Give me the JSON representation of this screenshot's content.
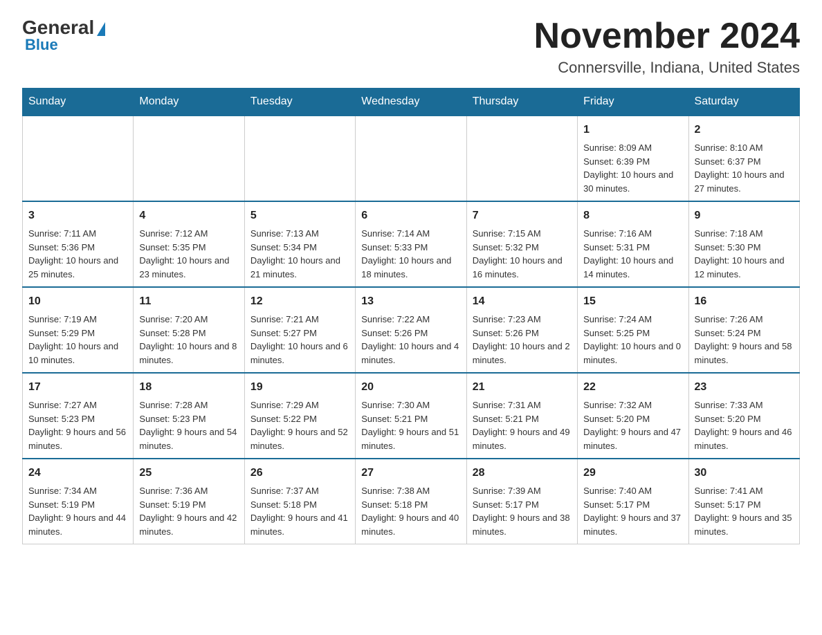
{
  "logo": {
    "general": "General",
    "triangle": "",
    "blue": "Blue"
  },
  "title": {
    "month": "November 2024",
    "location": "Connersville, Indiana, United States"
  },
  "headers": [
    "Sunday",
    "Monday",
    "Tuesday",
    "Wednesday",
    "Thursday",
    "Friday",
    "Saturday"
  ],
  "weeks": [
    [
      {
        "day": "",
        "detail": ""
      },
      {
        "day": "",
        "detail": ""
      },
      {
        "day": "",
        "detail": ""
      },
      {
        "day": "",
        "detail": ""
      },
      {
        "day": "",
        "detail": ""
      },
      {
        "day": "1",
        "detail": "Sunrise: 8:09 AM\nSunset: 6:39 PM\nDaylight: 10 hours and 30 minutes."
      },
      {
        "day": "2",
        "detail": "Sunrise: 8:10 AM\nSunset: 6:37 PM\nDaylight: 10 hours and 27 minutes."
      }
    ],
    [
      {
        "day": "3",
        "detail": "Sunrise: 7:11 AM\nSunset: 5:36 PM\nDaylight: 10 hours and 25 minutes."
      },
      {
        "day": "4",
        "detail": "Sunrise: 7:12 AM\nSunset: 5:35 PM\nDaylight: 10 hours and 23 minutes."
      },
      {
        "day": "5",
        "detail": "Sunrise: 7:13 AM\nSunset: 5:34 PM\nDaylight: 10 hours and 21 minutes."
      },
      {
        "day": "6",
        "detail": "Sunrise: 7:14 AM\nSunset: 5:33 PM\nDaylight: 10 hours and 18 minutes."
      },
      {
        "day": "7",
        "detail": "Sunrise: 7:15 AM\nSunset: 5:32 PM\nDaylight: 10 hours and 16 minutes."
      },
      {
        "day": "8",
        "detail": "Sunrise: 7:16 AM\nSunset: 5:31 PM\nDaylight: 10 hours and 14 minutes."
      },
      {
        "day": "9",
        "detail": "Sunrise: 7:18 AM\nSunset: 5:30 PM\nDaylight: 10 hours and 12 minutes."
      }
    ],
    [
      {
        "day": "10",
        "detail": "Sunrise: 7:19 AM\nSunset: 5:29 PM\nDaylight: 10 hours and 10 minutes."
      },
      {
        "day": "11",
        "detail": "Sunrise: 7:20 AM\nSunset: 5:28 PM\nDaylight: 10 hours and 8 minutes."
      },
      {
        "day": "12",
        "detail": "Sunrise: 7:21 AM\nSunset: 5:27 PM\nDaylight: 10 hours and 6 minutes."
      },
      {
        "day": "13",
        "detail": "Sunrise: 7:22 AM\nSunset: 5:26 PM\nDaylight: 10 hours and 4 minutes."
      },
      {
        "day": "14",
        "detail": "Sunrise: 7:23 AM\nSunset: 5:26 PM\nDaylight: 10 hours and 2 minutes."
      },
      {
        "day": "15",
        "detail": "Sunrise: 7:24 AM\nSunset: 5:25 PM\nDaylight: 10 hours and 0 minutes."
      },
      {
        "day": "16",
        "detail": "Sunrise: 7:26 AM\nSunset: 5:24 PM\nDaylight: 9 hours and 58 minutes."
      }
    ],
    [
      {
        "day": "17",
        "detail": "Sunrise: 7:27 AM\nSunset: 5:23 PM\nDaylight: 9 hours and 56 minutes."
      },
      {
        "day": "18",
        "detail": "Sunrise: 7:28 AM\nSunset: 5:23 PM\nDaylight: 9 hours and 54 minutes."
      },
      {
        "day": "19",
        "detail": "Sunrise: 7:29 AM\nSunset: 5:22 PM\nDaylight: 9 hours and 52 minutes."
      },
      {
        "day": "20",
        "detail": "Sunrise: 7:30 AM\nSunset: 5:21 PM\nDaylight: 9 hours and 51 minutes."
      },
      {
        "day": "21",
        "detail": "Sunrise: 7:31 AM\nSunset: 5:21 PM\nDaylight: 9 hours and 49 minutes."
      },
      {
        "day": "22",
        "detail": "Sunrise: 7:32 AM\nSunset: 5:20 PM\nDaylight: 9 hours and 47 minutes."
      },
      {
        "day": "23",
        "detail": "Sunrise: 7:33 AM\nSunset: 5:20 PM\nDaylight: 9 hours and 46 minutes."
      }
    ],
    [
      {
        "day": "24",
        "detail": "Sunrise: 7:34 AM\nSunset: 5:19 PM\nDaylight: 9 hours and 44 minutes."
      },
      {
        "day": "25",
        "detail": "Sunrise: 7:36 AM\nSunset: 5:19 PM\nDaylight: 9 hours and 42 minutes."
      },
      {
        "day": "26",
        "detail": "Sunrise: 7:37 AM\nSunset: 5:18 PM\nDaylight: 9 hours and 41 minutes."
      },
      {
        "day": "27",
        "detail": "Sunrise: 7:38 AM\nSunset: 5:18 PM\nDaylight: 9 hours and 40 minutes."
      },
      {
        "day": "28",
        "detail": "Sunrise: 7:39 AM\nSunset: 5:17 PM\nDaylight: 9 hours and 38 minutes."
      },
      {
        "day": "29",
        "detail": "Sunrise: 7:40 AM\nSunset: 5:17 PM\nDaylight: 9 hours and 37 minutes."
      },
      {
        "day": "30",
        "detail": "Sunrise: 7:41 AM\nSunset: 5:17 PM\nDaylight: 9 hours and 35 minutes."
      }
    ]
  ]
}
